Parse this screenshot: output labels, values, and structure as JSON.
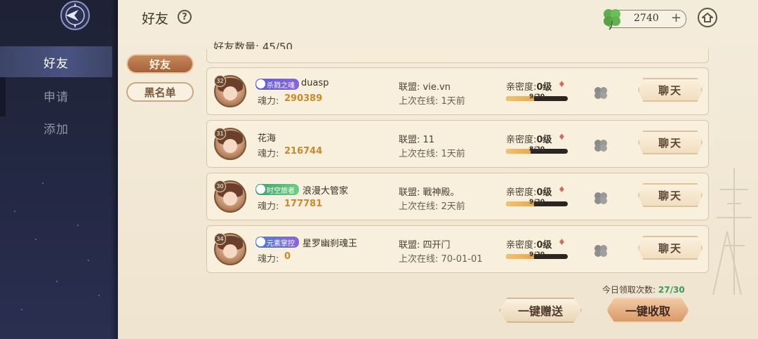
{
  "sidebar": {
    "items": [
      {
        "label": "好友",
        "active": true
      },
      {
        "label": "申请",
        "active": false
      },
      {
        "label": "添加",
        "active": false
      }
    ]
  },
  "header": {
    "title": "好友",
    "help_icon": "question-icon",
    "currency_amount": "2740",
    "currency_icon": "clover-icon",
    "currency_add": "+",
    "home_icon": "home-icon"
  },
  "friends_count": "好友数量: 45/50",
  "tabs": [
    {
      "label": "好友",
      "active": true
    },
    {
      "label": "黑名单",
      "active": false
    }
  ],
  "friends": [
    {
      "level": "32",
      "title_badge": "杀戮之魂",
      "name": "duasp",
      "soul_label": "魂力:",
      "soul_value": "290389",
      "alliance": "联盟: vie.vn",
      "last_online": "上次在线: 1天前",
      "intimacy": "亲密度:",
      "intimacy_level": "0级",
      "intimacy_progress": "9/20",
      "intimacy_fraction": 0.45,
      "chat_label": "聊天"
    },
    {
      "level": "31",
      "title_badge": "",
      "name": "花海",
      "soul_label": "魂力:",
      "soul_value": "216744",
      "alliance": "联盟: 11",
      "last_online": "上次在线: 1天前",
      "intimacy": "亲密度:",
      "intimacy_level": "0级",
      "intimacy_progress": "8/20",
      "intimacy_fraction": 0.4,
      "chat_label": "聊天"
    },
    {
      "level": "30",
      "title_badge": "时空旅者",
      "name": "浪漫大管家",
      "soul_label": "魂力:",
      "soul_value": "177781",
      "alliance": "联盟: 戰神殿。",
      "last_online": "上次在线: 2天前",
      "intimacy": "亲密度:",
      "intimacy_level": "0级",
      "intimacy_progress": "9/20",
      "intimacy_fraction": 0.45,
      "chat_label": "聊天"
    },
    {
      "level": "34",
      "title_badge": "元素掌控",
      "name": "星罗幽刹魂王",
      "soul_label": "魂力:",
      "soul_value": "0",
      "alliance": "联盟: 四开门",
      "last_online": "上次在线: 70-01-01",
      "intimacy": "亲密度:",
      "intimacy_level": "0级",
      "intimacy_progress": "9/20",
      "intimacy_fraction": 0.45,
      "chat_label": "聊天"
    }
  ],
  "footer": {
    "daily_label": "今日领取次数:",
    "daily_value": "27/30",
    "send_all": "一键赠送",
    "claim_all": "一键收取"
  },
  "colors": {
    "sidebar_bg": "#232844",
    "accent_orange": "#c98a2a",
    "claim_green": "#3b9a62",
    "card_bg": "#f8efdc"
  }
}
